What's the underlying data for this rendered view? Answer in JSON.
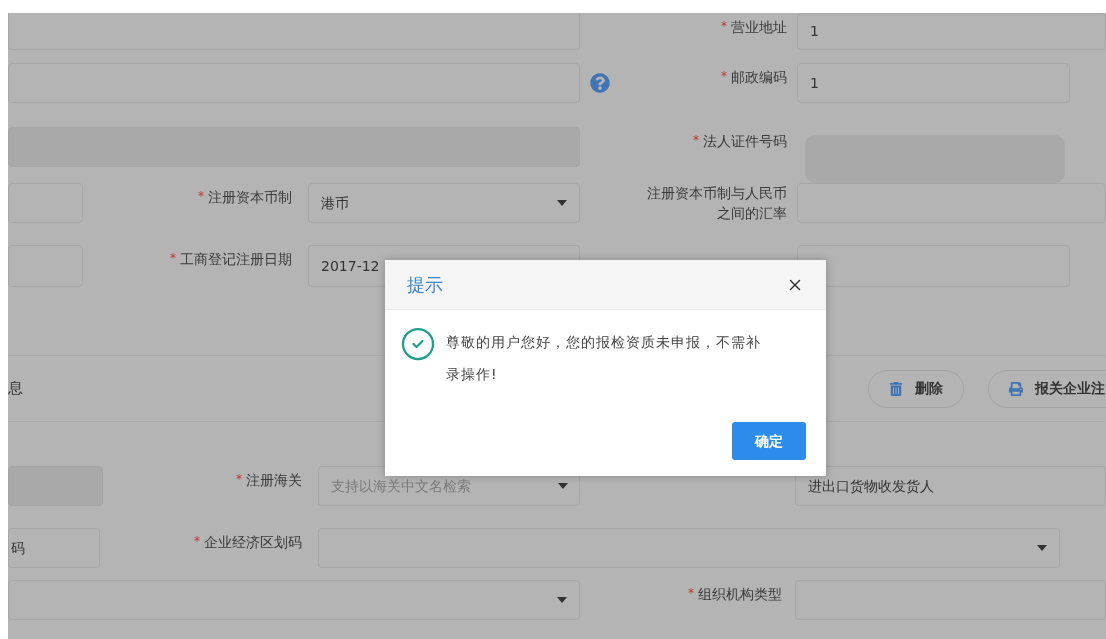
{
  "form": {
    "business_address": {
      "label": "营业地址",
      "mark": "*",
      "value": "1"
    },
    "postal_code": {
      "label": "邮政编码",
      "mark": "*",
      "value": "1"
    },
    "legal_id_number": {
      "label": "法人证件号码",
      "mark": "*"
    },
    "capital_currency": {
      "label": "注册资本币制",
      "mark": "*",
      "value": "港币"
    },
    "exchange_rate": {
      "label_lines": [
        "注册资本币制与人民币",
        "之间的汇率"
      ]
    },
    "registration_date": {
      "label": "工商登记注册日期",
      "mark": "*",
      "value": "2017-12"
    },
    "customs": {
      "label": "注册海关",
      "mark": "*",
      "placeholder": "支持以海关中文名检索"
    },
    "business_type": {
      "value": "进出口货物收发货人"
    },
    "left_code_field": {
      "value": "码"
    },
    "economic_zone_code": {
      "label": "企业经济区划码",
      "mark": "*"
    },
    "org_type": {
      "label": "组织机构类型",
      "mark": "*"
    }
  },
  "section": {
    "title": "息",
    "buttons": [
      {
        "label": "删除",
        "kind": "delete"
      },
      {
        "label": "报关企业注",
        "kind": "print"
      }
    ]
  },
  "dialog": {
    "title": "提示",
    "message": "尊敬的用户您好，您的报检资质未申报，不需补录操作!",
    "confirm": "确定"
  }
}
